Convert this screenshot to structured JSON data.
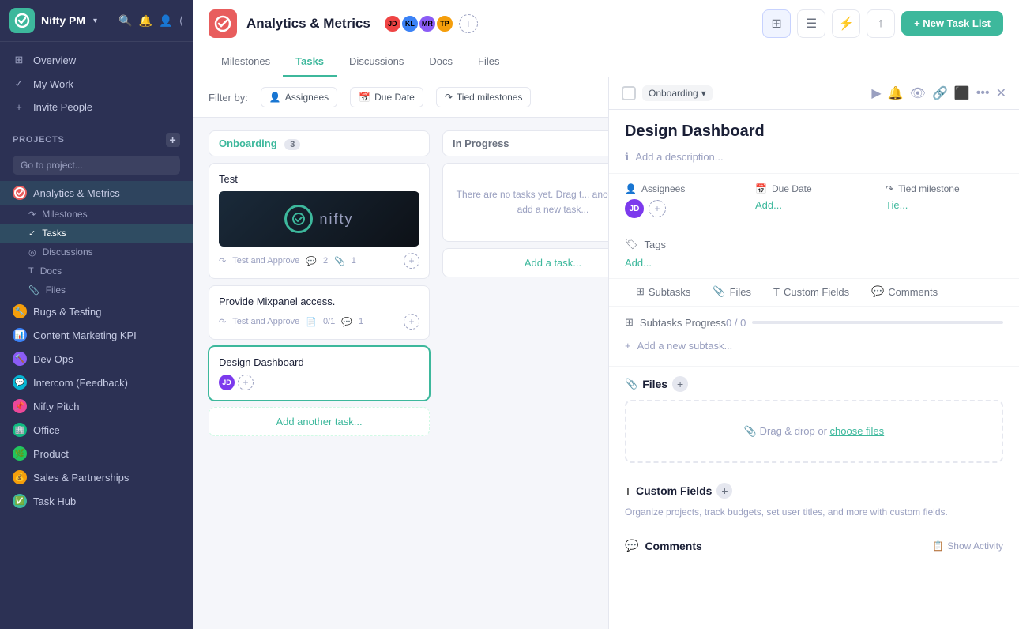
{
  "app": {
    "name": "Nifty PM",
    "arrow": "▾"
  },
  "sidebar": {
    "nav": [
      {
        "id": "overview",
        "label": "Overview",
        "icon": "⊞"
      },
      {
        "id": "my-work",
        "label": "My Work",
        "icon": "✓"
      },
      {
        "id": "invite",
        "label": "Invite People",
        "icon": "+"
      }
    ],
    "projects_label": "PROJECTS",
    "go_to_placeholder": "Go to project...",
    "projects": [
      {
        "id": "analytics",
        "label": "Analytics & Metrics",
        "color": "#e85d5d",
        "initial": "A",
        "active": true
      },
      {
        "id": "bugs",
        "label": "Bugs & Testing",
        "color": "#f59e0b",
        "initial": "B",
        "active": false
      },
      {
        "id": "content",
        "label": "Content Marketing KPI",
        "color": "#3b82f6",
        "initial": "C",
        "active": false
      },
      {
        "id": "devops",
        "label": "Dev Ops",
        "color": "#8b5cf6",
        "initial": "D",
        "active": false
      },
      {
        "id": "intercom",
        "label": "Intercom (Feedback)",
        "color": "#06b6d4",
        "initial": "I",
        "active": false
      },
      {
        "id": "pitch",
        "label": "Nifty Pitch",
        "color": "#ec4899",
        "initial": "N",
        "active": false
      },
      {
        "id": "office",
        "label": "Office",
        "color": "#10b981",
        "initial": "O",
        "active": false
      },
      {
        "id": "product",
        "label": "Product",
        "color": "#22c55e",
        "initial": "P",
        "active": false
      },
      {
        "id": "sales",
        "label": "Sales & Partnerships",
        "color": "#f59e0b",
        "initial": "S",
        "active": false
      },
      {
        "id": "taskhub",
        "label": "Task Hub",
        "color": "#3db89c",
        "initial": "T",
        "active": false
      }
    ],
    "analytics_children": [
      {
        "id": "milestones",
        "label": "Milestones",
        "icon": "↷"
      },
      {
        "id": "tasks",
        "label": "Tasks",
        "icon": "✓",
        "active": true
      },
      {
        "id": "discussions",
        "label": "Discussions",
        "icon": "◎"
      },
      {
        "id": "docs",
        "label": "Docs",
        "icon": "T"
      },
      {
        "id": "files",
        "label": "Files",
        "icon": "📎"
      }
    ]
  },
  "topbar": {
    "project_name": "Analytics & Metrics",
    "tabs": [
      "Milestones",
      "Tasks",
      "Discussions",
      "Docs",
      "Files"
    ],
    "active_tab": "Tasks",
    "new_task_btn": "+ New Task List"
  },
  "filter_bar": {
    "label": "Filter by:",
    "filters": [
      "Assignees",
      "Due Date",
      "Tied milestones"
    ]
  },
  "onboarding_list": {
    "title": "Onboarding",
    "count": "3",
    "tasks": [
      {
        "id": "test",
        "title": "Test",
        "has_image": true,
        "meta_task": "Test and Approve",
        "comments": "2",
        "attachments": "1"
      },
      {
        "id": "mixpanel",
        "title": "Provide  Mixpanel access.",
        "has_image": false,
        "meta_task": "Test and Approve",
        "docs": "0/1",
        "comments": "1"
      },
      {
        "id": "dashboard",
        "title": "Design Dashboard",
        "has_image": false,
        "meta_task": "",
        "comments": "",
        "attachments": ""
      }
    ],
    "add_task_label": "Add another task..."
  },
  "inprogress_list": {
    "title": "In Progress",
    "empty_text": "There are no tasks yet. Drag t... another list or add a new task...",
    "add_task_label": "Add a task..."
  },
  "right_panel": {
    "status": "Onboarding",
    "title": "Design Dashboard",
    "description_placeholder": "Add a description...",
    "assignees_label": "Assignees",
    "due_date_label": "Due Date",
    "due_date_value": "Add...",
    "tied_milestone_label": "Tied milestone",
    "tied_milestone_value": "Tie...",
    "tags_label": "Tags",
    "tags_add": "Add...",
    "subtasks_label": "Subtasks",
    "files_tab": "Files",
    "custom_fields_tab": "Custom Fields",
    "comments_tab": "Comments",
    "subtasks_progress_label": "Subtasks Progress",
    "subtasks_progress_value": "0 / 0",
    "add_subtask_label": "Add a new subtask...",
    "files_title": "Files",
    "drop_zone_text": "Drag & drop or ",
    "drop_zone_link": "choose files",
    "custom_fields_title": "Custom Fields",
    "custom_fields_desc": "Organize projects, track budgets, set user titles, and more with custom fields.",
    "comments_title": "Comments",
    "show_activity": "Show Activity"
  }
}
